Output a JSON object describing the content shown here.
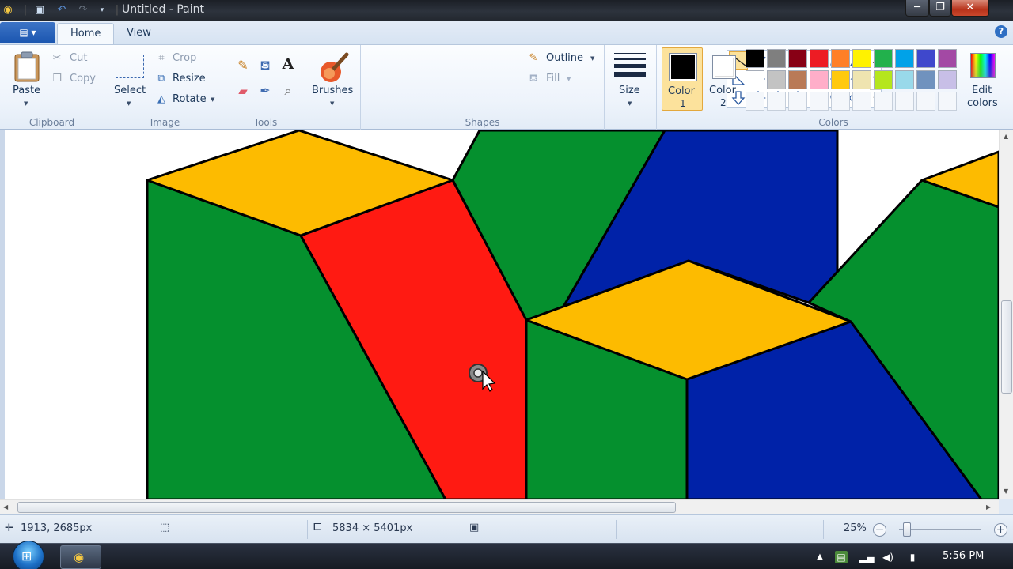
{
  "titlebar": {
    "title": "Untitled - Paint",
    "quick_access_icons": [
      "paint-app-icon",
      "save-icon",
      "undo-icon",
      "redo-icon",
      "customize-icon"
    ],
    "window_buttons": {
      "minimize": "─",
      "maximize": "❐",
      "close": "✕"
    }
  },
  "tabs": {
    "home": "Home",
    "view": "View",
    "help": "?"
  },
  "clipboard": {
    "paste": "Paste",
    "cut": "Cut",
    "copy": "Copy",
    "label": "Clipboard"
  },
  "image": {
    "select": "Select",
    "crop": "Crop",
    "resize": "Resize",
    "rotate": "Rotate",
    "label": "Image"
  },
  "tools": {
    "label": "Tools",
    "text_glyph": "A"
  },
  "brushes": {
    "label": "Brushes"
  },
  "shapes": {
    "outline": "Outline",
    "fill": "Fill",
    "label": "Shapes",
    "selected": "line"
  },
  "size": {
    "label": "Size"
  },
  "colors": {
    "color1_label": "Color",
    "color1_num": "1",
    "color2_label": "Color",
    "color2_num": "2",
    "color1": "#000000",
    "color2": "#ffffff",
    "edit_label": "Edit",
    "edit_label2": "colors",
    "label": "Colors",
    "palette_row1": [
      "#000000",
      "#7f7f7f",
      "#880015",
      "#ed1c24",
      "#ff7f27",
      "#fff200",
      "#22b14c",
      "#00a2e8",
      "#3f48cc",
      "#a349a4"
    ],
    "palette_row2": [
      "#ffffff",
      "#c3c3c3",
      "#b97a57",
      "#ffaec9",
      "#ffc90e",
      "#efe4b0",
      "#b5e61d",
      "#99d9ea",
      "#7092be",
      "#c8bfe7"
    ]
  },
  "canvas": {
    "colors": {
      "green": "#05902e",
      "yellow": "#fdbb00",
      "red": "#ff1a12",
      "blue": "#0022a8",
      "outline": "#000000"
    }
  },
  "status": {
    "cursor_position": "1913, 2685px",
    "image_size": "5834 × 5401px",
    "zoom": "25%",
    "zoom_out": "−",
    "zoom_in": "+"
  },
  "taskbar": {
    "time": "5:56 PM"
  }
}
